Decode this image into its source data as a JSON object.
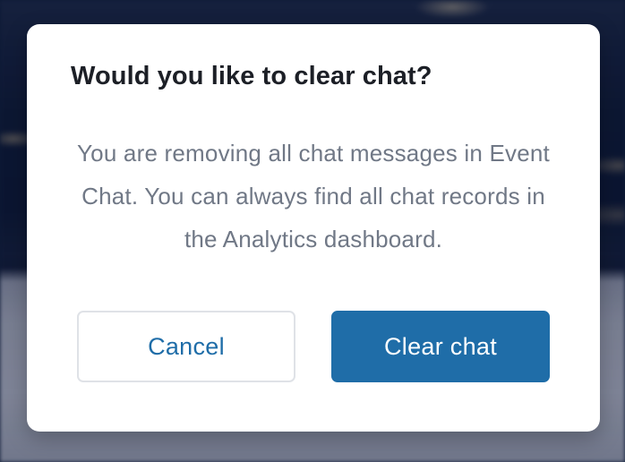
{
  "dialog": {
    "title": "Would you like to clear chat?",
    "message": "You are removing all chat messages in Event Chat. You can always find all chat records in the Analytics dashboard.",
    "cancel_label": "Cancel",
    "confirm_label": "Clear chat"
  },
  "colors": {
    "primary": "#1f6da8",
    "title_text": "#1c1f26",
    "body_text": "#707886",
    "cancel_border": "#dfe2e7",
    "modal_background": "#ffffff"
  }
}
